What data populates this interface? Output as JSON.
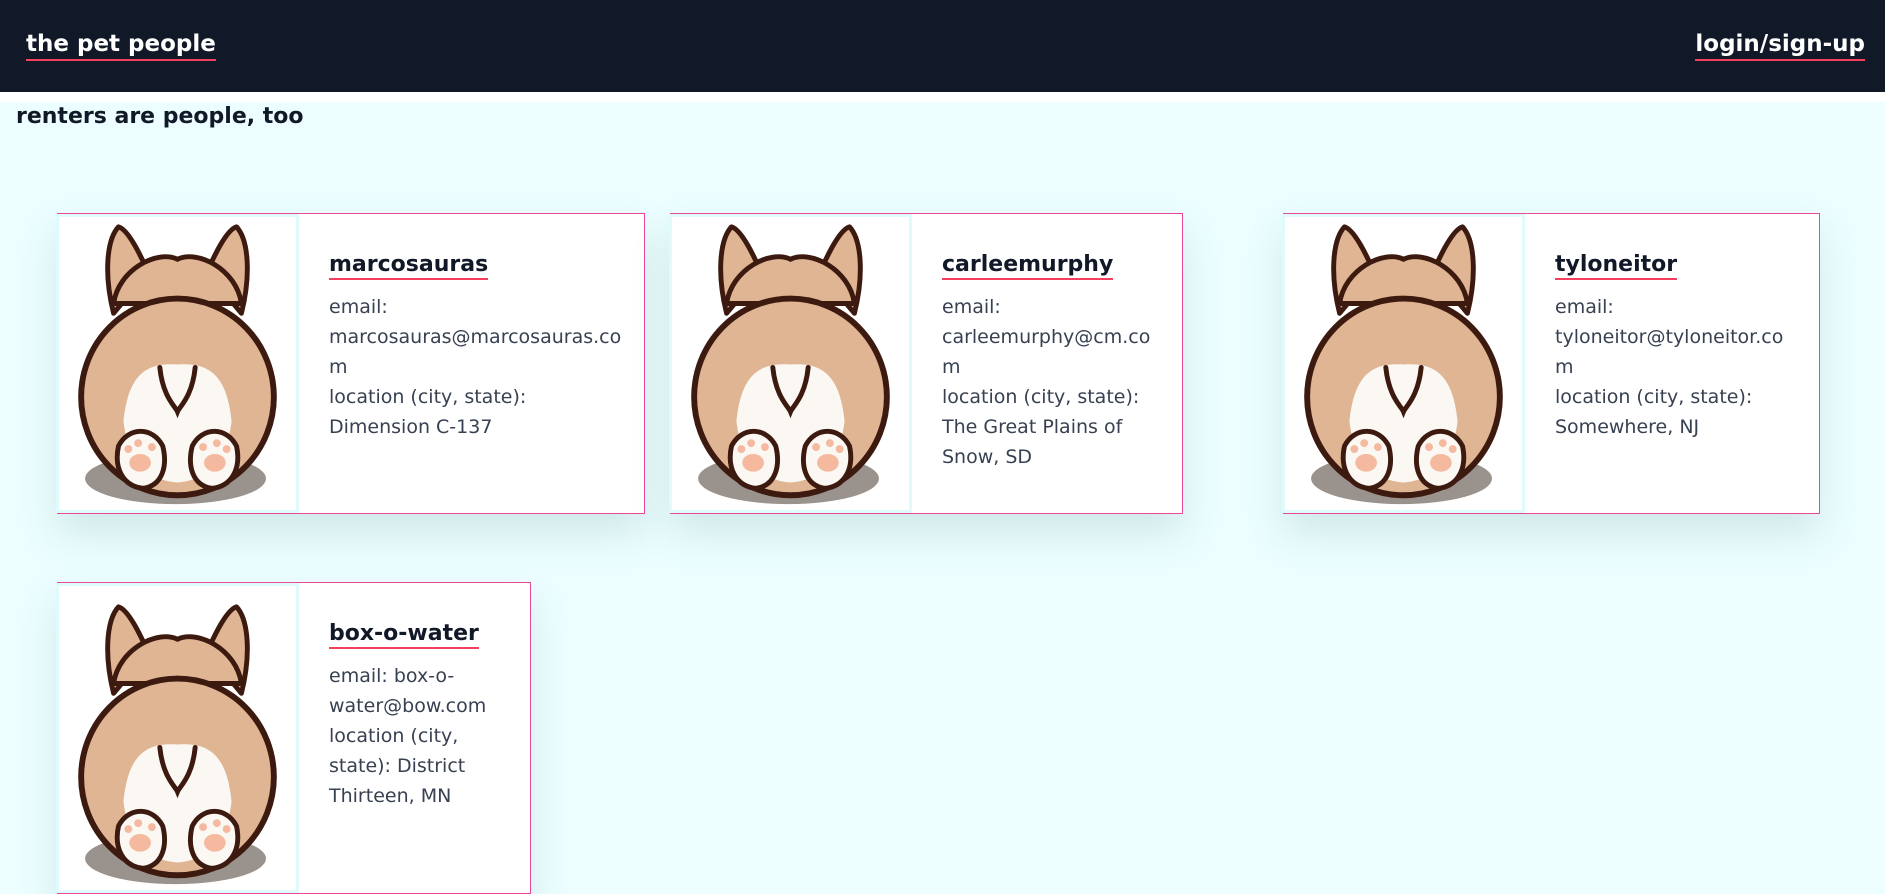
{
  "header": {
    "brand": "the pet people",
    "login": "login/sign-up"
  },
  "tagline": "renters are people, too",
  "renters": [
    {
      "name": "marcosauras",
      "email_line": "email: marcosauras@marcosauras.com",
      "location_line": "location (city, state): Dimension C-137",
      "avatar": "corgi-butt-icon"
    },
    {
      "name": "carleemurphy",
      "email_line": "email: carleemurphy@cm.com",
      "location_line": "location (city, state): The Great Plains of Snow, SD",
      "avatar": "corgi-butt-icon"
    },
    {
      "name": "tyloneitor",
      "email_line": "email: tyloneitor@tyloneitor.com",
      "location_line": "location (city, state): Somewhere, NJ",
      "avatar": "corgi-butt-icon"
    },
    {
      "name": "box-o-water",
      "email_line": "email: box-o-water@bow.com",
      "location_line": "location (city, state): District Thirteen, MN",
      "avatar": "corgi-butt-icon"
    }
  ],
  "colors": {
    "header_bg": "#111827",
    "page_bg": "#ecfeff",
    "accent": "#f43f5e",
    "card_border": "#ec4899"
  }
}
